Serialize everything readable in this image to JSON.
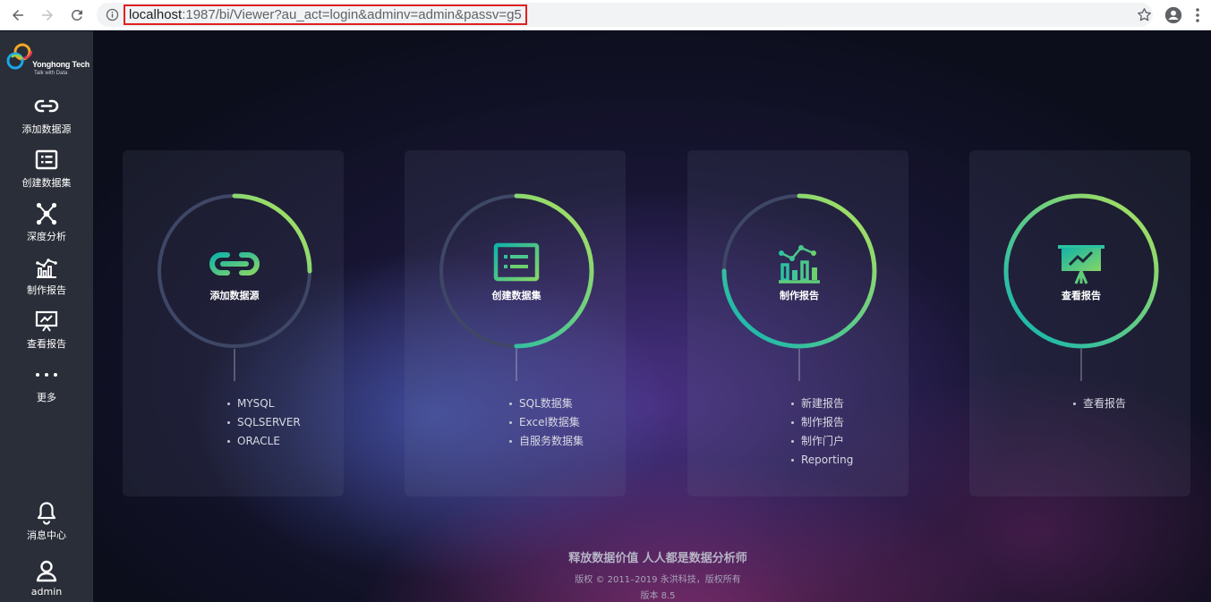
{
  "browser": {
    "url_host": "localhost",
    "url_rest": ":1987/bi/Viewer?au_act=login&adminv=admin&passv=g5"
  },
  "sidebar": {
    "logo_name": "Yonghong Tech",
    "logo_slogan": "Talk with Data",
    "items": [
      {
        "label": "添加数据源",
        "icon": "link-icon"
      },
      {
        "label": "创建数据集",
        "icon": "dataset-list-icon"
      },
      {
        "label": "深度分析",
        "icon": "network-icon"
      },
      {
        "label": "制作报告",
        "icon": "bar-chart-icon"
      },
      {
        "label": "查看报告",
        "icon": "presentation-icon"
      },
      {
        "label": "更多",
        "icon": "more-dots-icon"
      }
    ],
    "bottom": [
      {
        "label": "消息中心",
        "icon": "bell-icon"
      },
      {
        "label": "admin",
        "icon": "user-icon"
      }
    ]
  },
  "cards": [
    {
      "title": "添加数据源",
      "icon": "link-icon",
      "progress": 0.25,
      "items": [
        "MYSQL",
        "SQLSERVER",
        "ORACLE"
      ]
    },
    {
      "title": "创建数据集",
      "icon": "dataset-list-icon",
      "progress": 0.5,
      "items": [
        "SQL数据集",
        "Excel数据集",
        "自服务数据集"
      ]
    },
    {
      "title": "制作报告",
      "icon": "bar-chart-icon",
      "progress": 0.75,
      "items": [
        "新建报告",
        "制作报告",
        "制作门户",
        "Reporting"
      ]
    },
    {
      "title": "查看报告",
      "icon": "presentation-icon",
      "progress": 1.0,
      "items": [
        "查看报告"
      ]
    }
  ],
  "footer": {
    "slogan": "释放数据价值 人人都是数据分析师",
    "copyright": "版权 © 2011–2019 永洪科技，版权所有",
    "version": "版本 8.5"
  },
  "colors": {
    "ring_start": "#0ab3b5",
    "ring_end": "#b4e35a",
    "ring_track": "#3f4766",
    "icon_accent": "#2bc3a0",
    "url_highlight": "#e02020"
  }
}
